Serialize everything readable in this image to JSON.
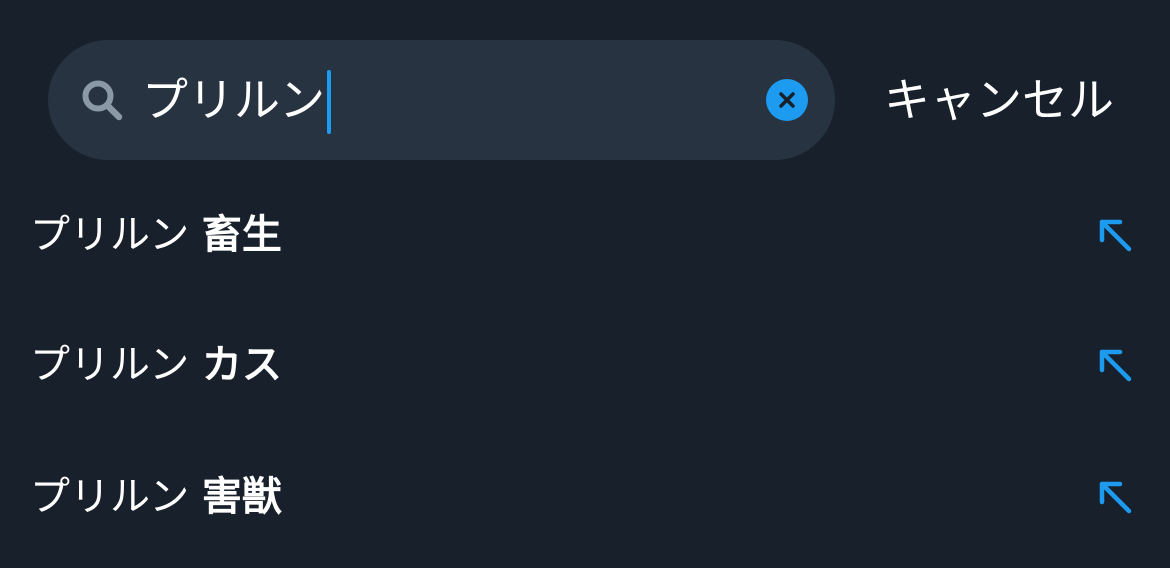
{
  "search": {
    "query": "プリルン",
    "cancel_label": "キャンセル"
  },
  "icons": {
    "search": "search-icon",
    "clear": "clear-icon",
    "fill_query": "arrow-up-left-icon"
  },
  "colors": {
    "background": "#18202b",
    "search_box": "#273340",
    "accent": "#1d9bf0",
    "text": "#ffffff",
    "search_icon": "#8b98a5"
  },
  "suggestions": [
    {
      "prefix": "プリルン",
      "completion": "畜生"
    },
    {
      "prefix": "プリルン",
      "completion": "カス"
    },
    {
      "prefix": "プリルン",
      "completion": "害獣"
    }
  ]
}
